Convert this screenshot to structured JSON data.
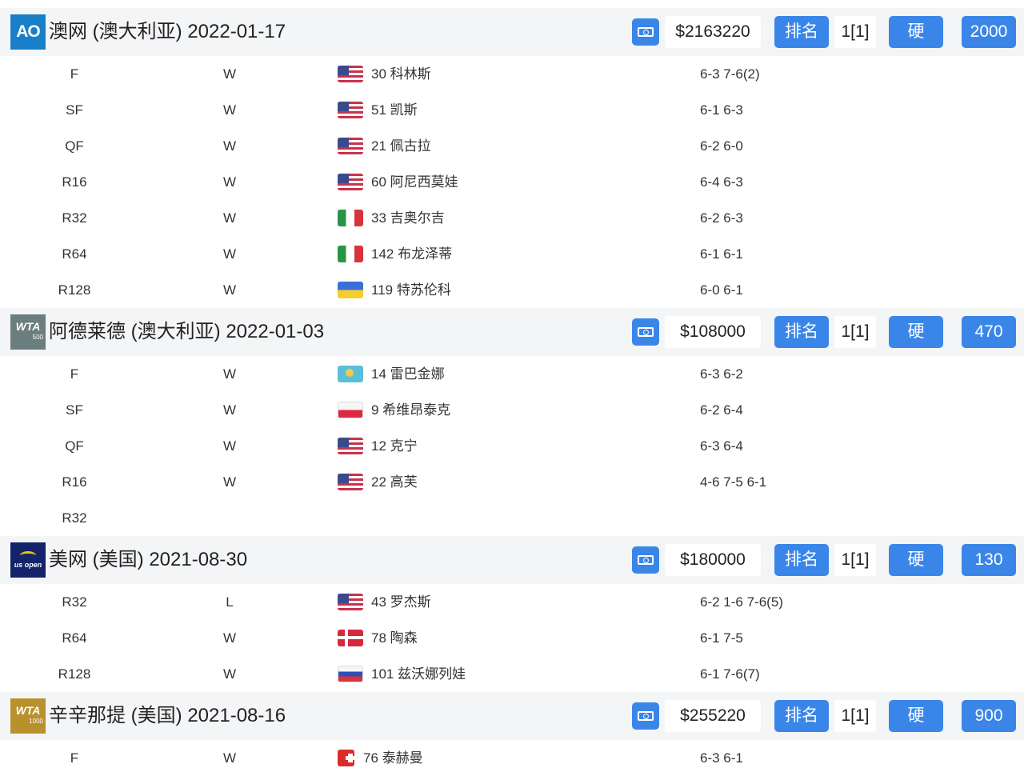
{
  "tournaments": [
    {
      "logo": "AO",
      "title": "澳网 (澳大利亚) 2022-01-17",
      "prize": "$2163220",
      "rank_label": "排名",
      "rank": "1[1]",
      "surface": "硬",
      "points": "2000",
      "matches": [
        {
          "round": "F",
          "result": "W",
          "flag": "us",
          "opponent": "30 科林斯",
          "score": "6-3 7-6(2)"
        },
        {
          "round": "SF",
          "result": "W",
          "flag": "us",
          "opponent": "51 凯斯",
          "score": "6-1 6-3"
        },
        {
          "round": "QF",
          "result": "W",
          "flag": "us",
          "opponent": "21 佩古拉",
          "score": "6-2 6-0"
        },
        {
          "round": "R16",
          "result": "W",
          "flag": "us",
          "opponent": "60 阿尼西莫娃",
          "score": "6-4 6-3"
        },
        {
          "round": "R32",
          "result": "W",
          "flag": "it",
          "opponent": "33 吉奥尔吉",
          "score": "6-2 6-3"
        },
        {
          "round": "R64",
          "result": "W",
          "flag": "it",
          "opponent": "142 布龙泽蒂",
          "score": "6-1 6-1"
        },
        {
          "round": "R128",
          "result": "W",
          "flag": "ua",
          "opponent": "119 特苏伦科",
          "score": "6-0 6-1"
        }
      ]
    },
    {
      "logo": "WTA",
      "logo_sub": "500",
      "title": "阿德莱德 (澳大利亚) 2022-01-03",
      "prize": "$108000",
      "rank_label": "排名",
      "rank": "1[1]",
      "surface": "硬",
      "points": "470",
      "matches": [
        {
          "round": "F",
          "result": "W",
          "flag": "kz",
          "opponent": "14 雷巴金娜",
          "score": "6-3 6-2"
        },
        {
          "round": "SF",
          "result": "W",
          "flag": "pl",
          "opponent": "9 希维昂泰克",
          "score": "6-2 6-4"
        },
        {
          "round": "QF",
          "result": "W",
          "flag": "us",
          "opponent": "12 克宁",
          "score": "6-3 6-4"
        },
        {
          "round": "R16",
          "result": "W",
          "flag": "us",
          "opponent": "22 高芙",
          "score": "4-6 7-5 6-1"
        },
        {
          "round": "R32",
          "result": "",
          "flag": "",
          "opponent": "",
          "score": ""
        }
      ]
    },
    {
      "logo": "us open",
      "title": "美网 (美国) 2021-08-30",
      "prize": "$180000",
      "rank_label": "排名",
      "rank": "1[1]",
      "surface": "硬",
      "points": "130",
      "matches": [
        {
          "round": "R32",
          "result": "L",
          "flag": "us",
          "opponent": "43 罗杰斯",
          "score": "6-2 1-6 7-6(5)"
        },
        {
          "round": "R64",
          "result": "W",
          "flag": "dk",
          "opponent": "78 陶森",
          "score": "6-1 7-5"
        },
        {
          "round": "R128",
          "result": "W",
          "flag": "ru",
          "opponent": "101 兹沃娜列娃",
          "score": "6-1 7-6(7)"
        }
      ]
    },
    {
      "logo": "WTA",
      "logo_sub": "1000",
      "title": "辛辛那提 (美国) 2021-08-16",
      "prize": "$255220",
      "rank_label": "排名",
      "rank": "1[1]",
      "surface": "硬",
      "points": "900",
      "matches": [
        {
          "round": "F",
          "result": "W",
          "flag": "ch",
          "opponent": "76 泰赫曼",
          "score": "6-3 6-1"
        }
      ]
    }
  ]
}
